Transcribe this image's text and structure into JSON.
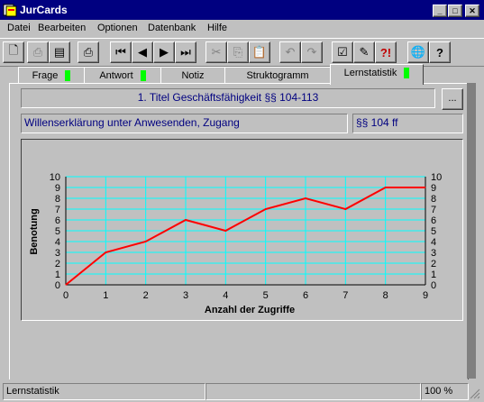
{
  "window": {
    "title": "JurCards"
  },
  "menu": [
    "Datei",
    "Bearbeiten",
    "Optionen",
    "Datenbank",
    "Hilfe"
  ],
  "tabs": [
    {
      "label": "Frage",
      "marker": true
    },
    {
      "label": "Antwort",
      "marker": true
    },
    {
      "label": "Notiz",
      "marker": false
    },
    {
      "label": "Struktogramm",
      "marker": false
    },
    {
      "label": "Lernstatistik",
      "marker": true
    }
  ],
  "card": {
    "title": "1. Titel Geschäftsfähigkeit §§ 104-113",
    "subject": "Willenserklärung unter Anwesenden, Zugang",
    "paragraph": "§§ 104 ff",
    "more_button": "..."
  },
  "chart_data": {
    "type": "line",
    "x": [
      0,
      1,
      2,
      3,
      4,
      5,
      6,
      7,
      8,
      9
    ],
    "series": [
      {
        "values": [
          0,
          3,
          4,
          6,
          5,
          7,
          8,
          7,
          9,
          9
        ],
        "color": "#ff0000"
      }
    ],
    "xlabel": "Anzahl der Zugriffe",
    "ylabel": "Benotung",
    "xlim": [
      0,
      9
    ],
    "ylim": [
      0,
      10
    ],
    "x_ticks": [
      "0",
      "1",
      "2",
      "3",
      "4",
      "5",
      "6",
      "7",
      "8",
      "9"
    ],
    "y_ticks": [
      "0",
      "1",
      "2",
      "3",
      "4",
      "5",
      "6",
      "7",
      "8",
      "9",
      "10"
    ],
    "grid": true,
    "grid_color": "#00ffff"
  },
  "status": {
    "left": "Lernstatistik",
    "zoom": "100 %"
  }
}
